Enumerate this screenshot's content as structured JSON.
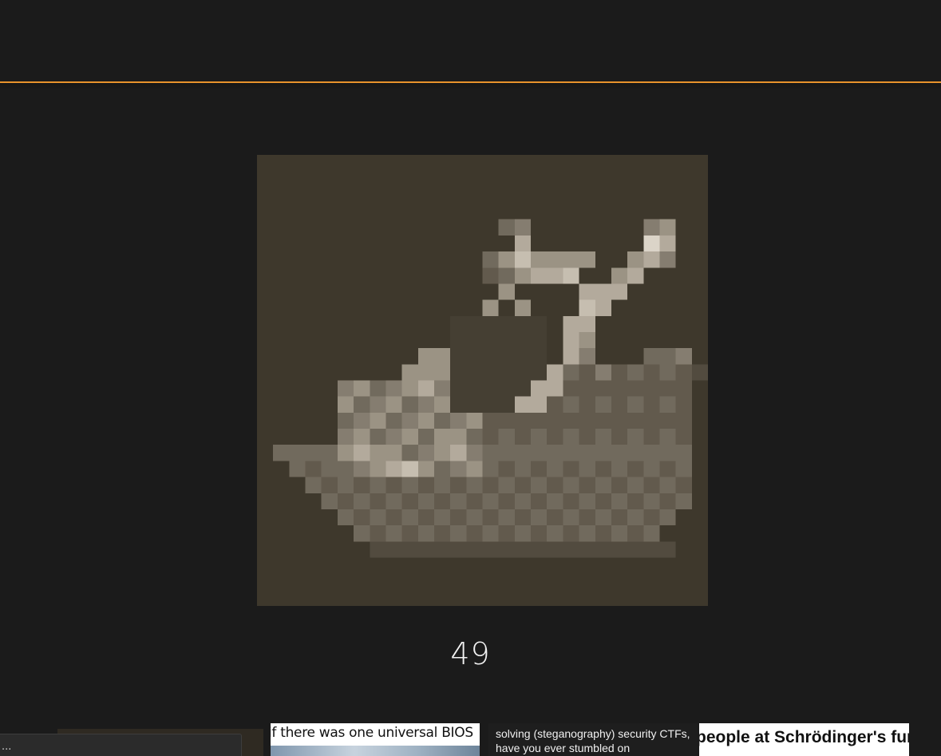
{
  "header": {
    "accent_color": "#e8932c"
  },
  "viewer": {
    "image_name": "pixelated-boat-image",
    "counter": "49"
  },
  "toast": {
    "text": "..."
  },
  "thumbnails": [
    {
      "caption": "if there was one universal BIOS"
    },
    {
      "caption": "solving (steganography) security CTFs, have you ever stumbled on"
    },
    {
      "caption": "people at Schrödinger's funeral watching his coffin"
    }
  ]
}
